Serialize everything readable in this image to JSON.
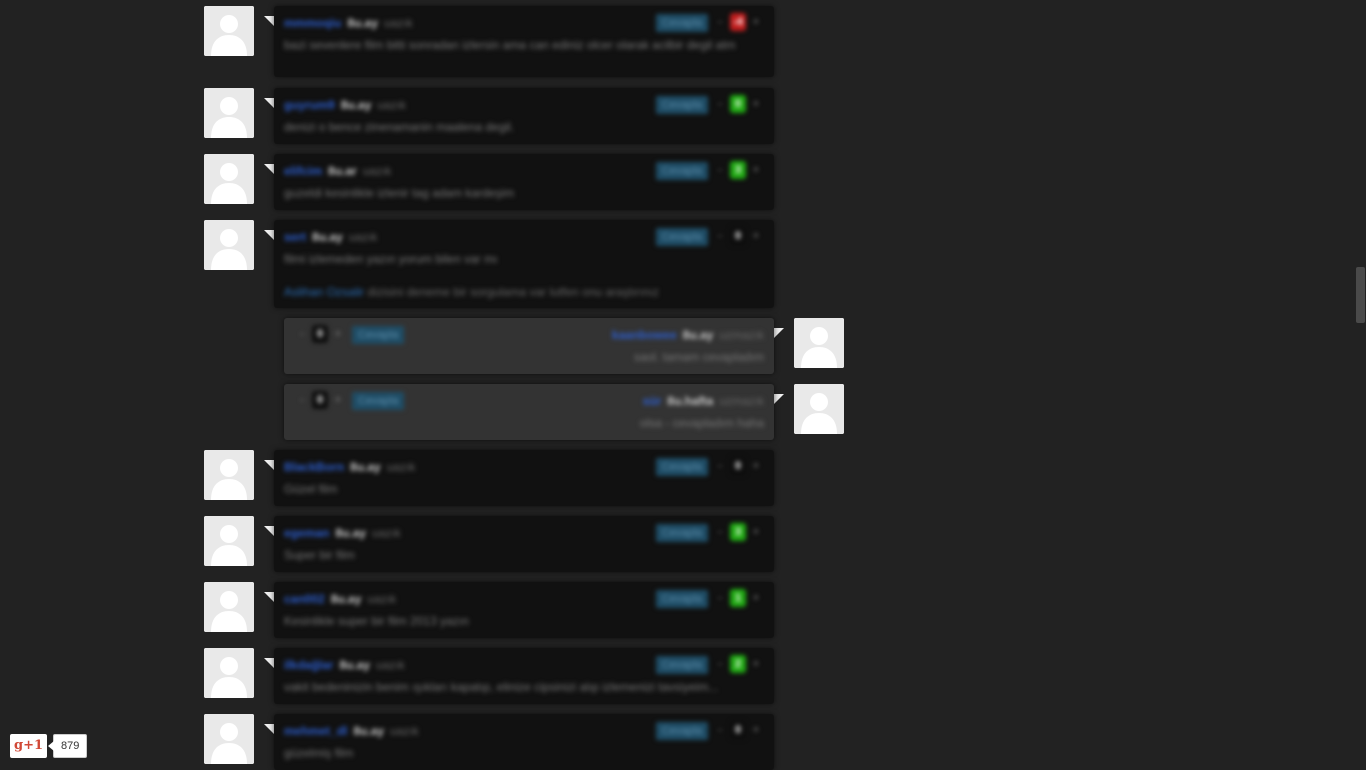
{
  "comments": [
    {
      "user": "mmmoqiu",
      "age": "8u.ay",
      "ago": "uazık",
      "text": "bazi sevenlere film bitti sonradan izlersin ama can ediniz olcer olarak acilbir degil atm",
      "score": "-4",
      "score_type": "neg",
      "reply_label": "Cevapla",
      "minus": "-",
      "plus": "+"
    },
    {
      "user": "guyrum9",
      "age": "8u.ay",
      "ago": "uazık",
      "text": "denizi o bence zinenamanin maalena degil.",
      "score": "0",
      "score_type": "pos",
      "reply_label": "Cevapla",
      "minus": "-",
      "plus": "+"
    },
    {
      "user": "elifcim",
      "age": "8u.ar",
      "ago": "uazık",
      "text": "guzeldi kesinlikle izlenir tag adam kardeşim",
      "score": "3",
      "score_type": "pos",
      "reply_label": "Cevapla",
      "minus": "-",
      "plus": "+"
    },
    {
      "user": "sert",
      "age": "8u.ay",
      "ago": "uazık",
      "text": "filmi izlemeden yazın yorum bilen var mı",
      "score": "0",
      "score_type": "neutral",
      "reply_label": "Cevapla",
      "minus": "-",
      "plus": "+",
      "extra_link": "Aslihan Ozsalir",
      "extra_text": "dizisini deneme bir sorgulama var lutfen onu araştırınız"
    },
    {
      "user": "kaanbowee",
      "age": "8u.ay",
      "ago": "uzmazık",
      "text": "saol. tamam cevapladım",
      "score": "0",
      "score_type": "neutral",
      "reply_label": "Cevapla",
      "minus": "-",
      "plus": "+",
      "reply": true
    },
    {
      "user": "sür",
      "age": "8u.hafta",
      "ago": "uzmazık",
      "text": "olsa - cevapladım haha",
      "score": "0",
      "score_type": "neutral",
      "reply_label": "Cevapla",
      "minus": "-",
      "plus": "+",
      "reply": true
    },
    {
      "user": "BlackBorn",
      "age": "8u.ay",
      "ago": "uazık",
      "text": "Güzel film",
      "score": "0",
      "score_type": "neutral",
      "reply_label": "Cevapla",
      "minus": "-",
      "plus": "+"
    },
    {
      "user": "egeman",
      "age": "8u.ay",
      "ago": "uazık",
      "text": "Super bir film",
      "score": "3",
      "score_type": "pos",
      "reply_label": "Cevapla",
      "minus": "-",
      "plus": "+"
    },
    {
      "user": "can002",
      "age": "8u.ay",
      "ago": "uazık",
      "text": "Kesinlikle super bir film 2013 yazın",
      "score": "1",
      "score_type": "pos",
      "reply_label": "Cevapla",
      "minus": "-",
      "plus": "+"
    },
    {
      "user": "ilkdağlar",
      "age": "8u.ay",
      "ago": "uazık",
      "text": "vakit bedeninizin benim ışıkları kapatıp, elinize cipsinizi alıp izlemenizi tavsiyeim...",
      "score": "2",
      "score_type": "pos",
      "reply_label": "Cevapla",
      "minus": "-",
      "plus": "+"
    },
    {
      "user": "mehmet_dl",
      "age": "8u.ay",
      "ago": "uazık",
      "text": "güzelmiş film",
      "score": "0",
      "score_type": "neutral",
      "reply_label": "Cevapla",
      "minus": "-",
      "plus": "+"
    }
  ],
  "gplus": {
    "label": "g+1",
    "count": "879"
  },
  "colors": {
    "background": "#222222",
    "bubble": "#111111",
    "reply_bubble": "#333333",
    "username": "#2d5fd0",
    "positive": "#1faa12",
    "negative": "#c21d1d",
    "reply_button": "#1f4d66"
  },
  "icons": {
    "avatar": "default-avatar-icon",
    "gplus": "google-plus-one-icon"
  }
}
